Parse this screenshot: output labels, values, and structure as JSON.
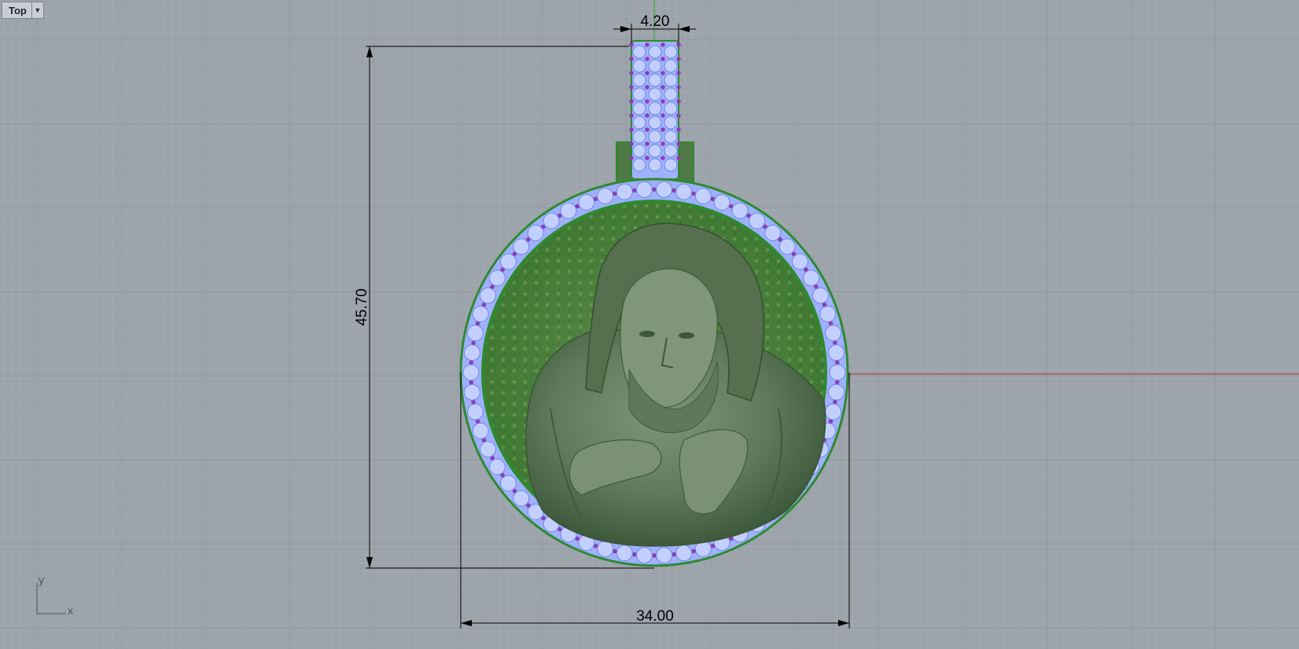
{
  "viewport": {
    "name": "Top",
    "dropdown_icon": "chevron-down-icon"
  },
  "dimensions": {
    "bail_width": "4.20",
    "height": "45.70",
    "width": "34.00"
  },
  "axes": {
    "x_label": "x",
    "y_label": "y"
  },
  "colors": {
    "background": "#9aa1a8",
    "grid_minor": "#a5acb3",
    "grid_major": "#8a9299",
    "x_axis": "#b3413f",
    "y_axis": "#3f9f3f",
    "pendant_green": "#5a7a52",
    "gem_blue": "#a8b8ff",
    "gem_purple": "#8a3fb5",
    "dimension_line": "#000000"
  },
  "model": {
    "object": "medallion-pendant-with-portrait-relief"
  }
}
